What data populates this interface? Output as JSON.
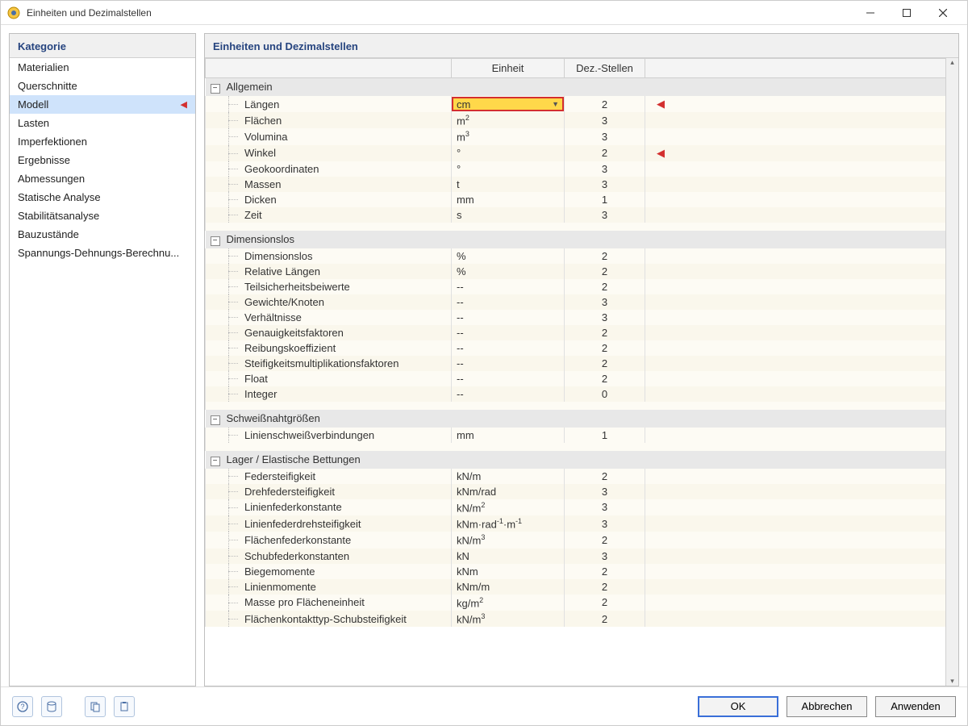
{
  "window": {
    "title": "Einheiten und Dezimalstellen"
  },
  "sidebar": {
    "header": "Kategorie",
    "items": [
      {
        "label": "Materialien",
        "selected": false,
        "marked": false
      },
      {
        "label": "Querschnitte",
        "selected": false,
        "marked": false
      },
      {
        "label": "Modell",
        "selected": true,
        "marked": true
      },
      {
        "label": "Lasten",
        "selected": false,
        "marked": false
      },
      {
        "label": "Imperfektionen",
        "selected": false,
        "marked": false
      },
      {
        "label": "Ergebnisse",
        "selected": false,
        "marked": false
      },
      {
        "label": "Abmessungen",
        "selected": false,
        "marked": false
      },
      {
        "label": "Statische Analyse",
        "selected": false,
        "marked": false
      },
      {
        "label": "Stabilitätsanalyse",
        "selected": false,
        "marked": false
      },
      {
        "label": "Bauzustände",
        "selected": false,
        "marked": false
      },
      {
        "label": "Spannungs-Dehnungs-Berechnu...",
        "selected": false,
        "marked": false
      }
    ]
  },
  "main": {
    "header": "Einheiten und Dezimalstellen",
    "columns": {
      "name": "",
      "unit": "Einheit",
      "dec": "Dez.-Stellen",
      "mark": ""
    },
    "groups": [
      {
        "title": "Allgemein",
        "rows": [
          {
            "name": "Längen",
            "unit": "cm",
            "dec": "2",
            "marked": true,
            "dropdown": true
          },
          {
            "name": "Flächen",
            "unit_html": "m<sup>2</sup>",
            "dec": "3"
          },
          {
            "name": "Volumina",
            "unit_html": "m<sup>3</sup>",
            "dec": "3"
          },
          {
            "name": "Winkel",
            "unit": "°",
            "dec": "2",
            "marked": true
          },
          {
            "name": "Geokoordinaten",
            "unit": "°",
            "dec": "3"
          },
          {
            "name": "Massen",
            "unit": "t",
            "dec": "3"
          },
          {
            "name": "Dicken",
            "unit": "mm",
            "dec": "1"
          },
          {
            "name": "Zeit",
            "unit": "s",
            "dec": "3"
          }
        ]
      },
      {
        "title": "Dimensionslos",
        "rows": [
          {
            "name": "Dimensionslos",
            "unit": "%",
            "dec": "2"
          },
          {
            "name": "Relative Längen",
            "unit": "%",
            "dec": "2"
          },
          {
            "name": "Teilsicherheitsbeiwerte",
            "unit": "--",
            "dec": "2"
          },
          {
            "name": "Gewichte/Knoten",
            "unit": "--",
            "dec": "3"
          },
          {
            "name": "Verhältnisse",
            "unit": "--",
            "dec": "3"
          },
          {
            "name": "Genauigkeitsfaktoren",
            "unit": "--",
            "dec": "2"
          },
          {
            "name": "Reibungskoeffizient",
            "unit": "--",
            "dec": "2"
          },
          {
            "name": "Steifigkeitsmultiplikationsfaktoren",
            "unit": "--",
            "dec": "2"
          },
          {
            "name": "Float",
            "unit": "--",
            "dec": "2"
          },
          {
            "name": "Integer",
            "unit": "--",
            "dec": "0"
          }
        ]
      },
      {
        "title": "Schweißnahtgrößen",
        "rows": [
          {
            "name": "Linienschweißverbindungen",
            "unit": "mm",
            "dec": "1"
          }
        ]
      },
      {
        "title": "Lager / Elastische Bettungen",
        "rows": [
          {
            "name": "Federsteifigkeit",
            "unit": "kN/m",
            "dec": "2"
          },
          {
            "name": "Drehfedersteifigkeit",
            "unit": "kNm/rad",
            "dec": "3"
          },
          {
            "name": "Linienfederkonstante",
            "unit_html": "kN/m<sup>2</sup>",
            "dec": "3"
          },
          {
            "name": "Linienfederdrehsteifigkeit",
            "unit_html": "kNm·rad<sup>-1</sup>·m<sup>-1</sup>",
            "dec": "3"
          },
          {
            "name": "Flächenfederkonstante",
            "unit_html": "kN/m<sup>3</sup>",
            "dec": "2"
          },
          {
            "name": "Schubfederkonstanten",
            "unit": "kN",
            "dec": "3"
          },
          {
            "name": "Biegemomente",
            "unit": "kNm",
            "dec": "2"
          },
          {
            "name": "Linienmomente",
            "unit": "kNm/m",
            "dec": "2"
          },
          {
            "name": "Masse pro Flächeneinheit",
            "unit_html": "kg/m<sup>2</sup>",
            "dec": "2"
          },
          {
            "name": "Flächenkontakttyp-Schubsteifigkeit",
            "unit_html": "kN/m<sup>3</sup>",
            "dec": "2"
          }
        ]
      }
    ]
  },
  "footer": {
    "buttons": {
      "ok": "OK",
      "cancel": "Abbrechen",
      "apply": "Anwenden"
    }
  }
}
